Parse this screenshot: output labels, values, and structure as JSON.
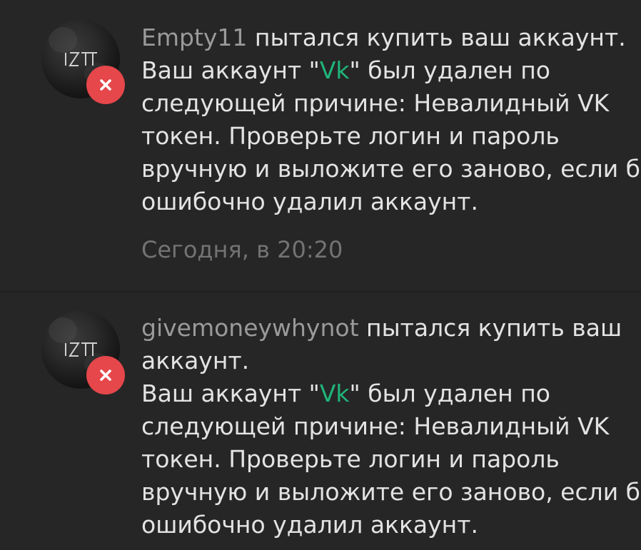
{
  "notifications": [
    {
      "username": "Empty11",
      "action": " пытался купить ваш аккаунт.",
      "lines": [
        {
          "pre": "Ваш аккаунт \"",
          "highlight": "Vk",
          "post": "\" был удален по"
        },
        "следующей причине: Невалидный VK",
        "токен. Проверьте логин и пароль",
        "вручную и выложите его заново, если бот",
        "ошибочно удалил аккаунт."
      ],
      "time": "Сегодня, в 20:20"
    },
    {
      "username": "givemoneywhynot",
      "action": " пытался купить ваш",
      "action_cont": "аккаунт.",
      "lines": [
        {
          "pre": "Ваш аккаунт \"",
          "highlight": "Vk",
          "post": "\" был удален по"
        },
        "следующей причине: Невалидный VK",
        "токен. Проверьте логин и пароль",
        "вручную и выложите его заново, если бот",
        "ошибочно удалил аккаунт."
      ]
    }
  ],
  "colors": {
    "background": "#262626",
    "text": "#e3e3e3",
    "username": "#9a9a9a",
    "highlight": "#1fb57a",
    "time": "#737373",
    "error_badge": "#e5474b"
  },
  "icons": {
    "status": "close-icon",
    "avatar_logo": "izc-logo-icon"
  }
}
